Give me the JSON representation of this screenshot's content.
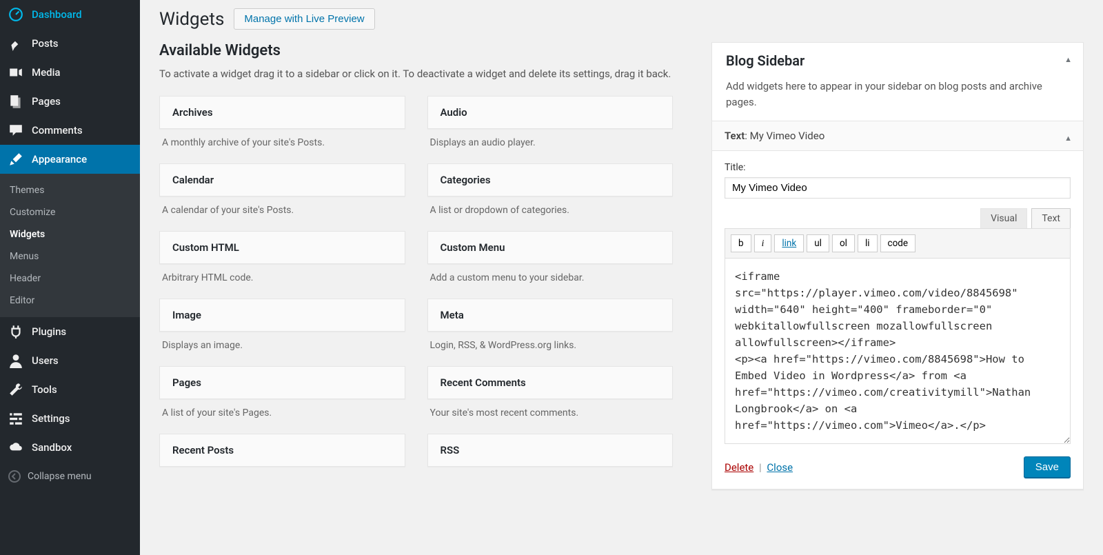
{
  "sidebar": {
    "items": [
      {
        "icon": "dashboard",
        "label": "Dashboard"
      },
      {
        "icon": "pin",
        "label": "Posts"
      },
      {
        "icon": "media",
        "label": "Media"
      },
      {
        "icon": "page",
        "label": "Pages"
      },
      {
        "icon": "comment",
        "label": "Comments"
      },
      {
        "icon": "brush",
        "label": "Appearance",
        "active": true,
        "submenu": [
          "Themes",
          "Customize",
          "Widgets",
          "Menus",
          "Header",
          "Editor"
        ],
        "submenu_current": "Widgets"
      },
      {
        "icon": "plug",
        "label": "Plugins"
      },
      {
        "icon": "user",
        "label": "Users"
      },
      {
        "icon": "wrench",
        "label": "Tools"
      },
      {
        "icon": "sliders",
        "label": "Settings"
      },
      {
        "icon": "cloud",
        "label": "Sandbox"
      }
    ],
    "collapse": "Collapse menu"
  },
  "page": {
    "title": "Widgets",
    "preview_btn": "Manage with Live Preview"
  },
  "available": {
    "heading": "Available Widgets",
    "desc": "To activate a widget drag it to a sidebar or click on it. To deactivate a widget and delete its settings, drag it back.",
    "widgets": [
      {
        "name": "Archives",
        "desc": "A monthly archive of your site's Posts."
      },
      {
        "name": "Audio",
        "desc": "Displays an audio player."
      },
      {
        "name": "Calendar",
        "desc": "A calendar of your site's Posts."
      },
      {
        "name": "Categories",
        "desc": "A list or dropdown of categories."
      },
      {
        "name": "Custom HTML",
        "desc": "Arbitrary HTML code."
      },
      {
        "name": "Custom Menu",
        "desc": "Add a custom menu to your sidebar."
      },
      {
        "name": "Image",
        "desc": "Displays an image."
      },
      {
        "name": "Meta",
        "desc": "Login, RSS, & WordPress.org links."
      },
      {
        "name": "Pages",
        "desc": "A list of your site's Pages."
      },
      {
        "name": "Recent Comments",
        "desc": "Your site's most recent comments."
      },
      {
        "name": "Recent Posts",
        "desc": ""
      },
      {
        "name": "RSS",
        "desc": ""
      }
    ]
  },
  "area": {
    "title": "Blog Sidebar",
    "desc": "Add widgets here to appear in your sidebar on blog posts and archive pages."
  },
  "widget": {
    "type": "Text",
    "title_suffix": "My Vimeo Video",
    "title_label": "Title:",
    "title_value": "My Vimeo Video",
    "tabs": {
      "visual": "Visual",
      "text": "Text"
    },
    "toolbar": [
      "b",
      "i",
      "link",
      "ul",
      "ol",
      "li",
      "code"
    ],
    "content": "<iframe src=\"https://player.vimeo.com/video/8845698\" width=\"640\" height=\"400\" frameborder=\"0\" webkitallowfullscreen mozallowfullscreen allowfullscreen></iframe>\n<p><a href=\"https://vimeo.com/8845698\">How to Embed Video in Wordpress</a> from <a href=\"https://vimeo.com/creativitymill\">Nathan Longbrook</a> on <a href=\"https://vimeo.com\">Vimeo</a>.</p>",
    "delete": "Delete",
    "close": "Close",
    "save": "Save"
  }
}
